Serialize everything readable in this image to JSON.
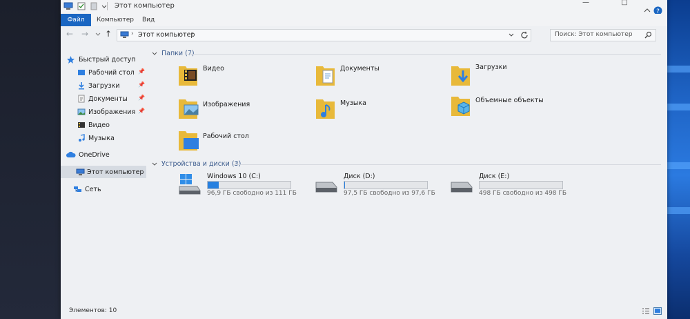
{
  "window": {
    "title": "Этот компьютер",
    "tabs": [
      "Файл",
      "Компьютер",
      "Вид"
    ],
    "address_path": "Этот компьютер",
    "search_placeholder": "Поиск: Этот компьютер"
  },
  "sidebar": {
    "quick_access": "Быстрый доступ",
    "quick_items": [
      "Рабочий стол",
      "Загрузки",
      "Документы",
      "Изображения",
      "Видео",
      "Музыка"
    ],
    "onedrive": "OneDrive",
    "this_pc": "Этот компьютер",
    "network": "Сеть"
  },
  "folders": {
    "header": "Папки (7)",
    "items": [
      "Видео",
      "Документы",
      "Загрузки",
      "Изображения",
      "Музыка",
      "Объемные объекты",
      "Рабочий стол"
    ]
  },
  "drives": {
    "header": "Устройства и диски (3)",
    "items": [
      {
        "name": "Windows 10 (C:)",
        "free": "96,9 ГБ свободно из 111 ГБ",
        "used_fraction": 0.13
      },
      {
        "name": "Диск (D:)",
        "free": "97,5 ГБ свободно из 97,6 ГБ",
        "used_fraction": 0.001
      },
      {
        "name": "Диск (E:)",
        "free": "498 ГБ свободно из 498 ГБ",
        "used_fraction": 0.0
      }
    ]
  },
  "status": {
    "count": "Элементов: 10"
  },
  "colors": {
    "accent": "#1a66c2",
    "folder": "#e8b93a",
    "drive_fill": "#2680e0"
  }
}
